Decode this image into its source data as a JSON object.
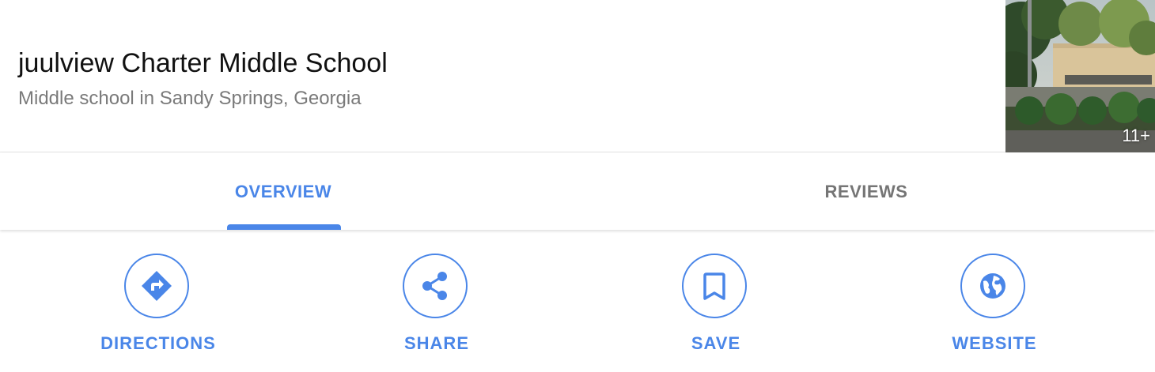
{
  "place": {
    "title": "juulview Charter Middle School",
    "subtitle": "Middle school in Sandy Springs, Georgia",
    "photo_count": "11+"
  },
  "tabs": [
    {
      "label": "OVERVIEW",
      "active": true
    },
    {
      "label": "REVIEWS",
      "active": false
    }
  ],
  "actions": [
    {
      "label": "DIRECTIONS",
      "icon": "directions-icon"
    },
    {
      "label": "SHARE",
      "icon": "share-icon"
    },
    {
      "label": "SAVE",
      "icon": "bookmark-icon"
    },
    {
      "label": "WEBSITE",
      "icon": "globe-icon"
    }
  ],
  "colors": {
    "accent": "#4a86e8",
    "inactive_tab": "#757575",
    "title": "#111111",
    "subtitle": "#7a7a7a"
  }
}
